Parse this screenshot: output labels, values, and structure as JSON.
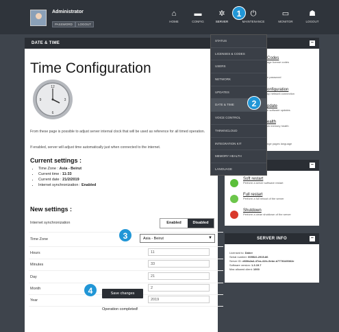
{
  "header": {
    "user_name": "Administrator",
    "password_btn": "PASSWORD",
    "logout_small_btn": "LOGOUT",
    "nav": [
      {
        "label": "HOME",
        "icon": "home-icon"
      },
      {
        "label": "CONFIG",
        "icon": "folder-icon"
      },
      {
        "label": "SERVER",
        "icon": "gear-icon"
      },
      {
        "label": "MAINTENANCE",
        "icon": "power-icon"
      },
      {
        "label": "MONITOR",
        "icon": "monitor-icon"
      },
      {
        "label": "LOGOUT",
        "icon": "user-logout-icon"
      }
    ]
  },
  "main": {
    "panel_title": "DATE & TIME",
    "heading": "Time Configuration",
    "desc1": "From these page is possible to adjust server internal clock that will be used as reference for all timed operation.",
    "desc2": "If enabled, server will adjust time automatically just when connected to the internet.",
    "current_title": "Current settings :",
    "current": [
      {
        "label": "Time Zone : ",
        "value": "Asia - Beirut"
      },
      {
        "label": "Current time : ",
        "value": "11:33"
      },
      {
        "label": "Current date : ",
        "value": "21/2/2019"
      },
      {
        "label": "Internet synchronization : ",
        "value": "Enabled"
      }
    ],
    "new_title": "New settings :",
    "sync_label": "Internet synchronization",
    "enabled_btn": "Enabled",
    "disabled_btn": "Disabled",
    "timezone_label": "Time Zone",
    "timezone_value": "Asia - Beirut",
    "hours_label": "Hours",
    "hours_value": "11",
    "minutes_label": "Minutes",
    "minutes_value": "33",
    "day_label": "Day",
    "day_value": "21",
    "month_label": "Month",
    "month_value": "2",
    "year_label": "Year",
    "year_value": "2019",
    "save_btn": "Save changes",
    "status_msg": "Operation completed!"
  },
  "dropdown": {
    "items": [
      "STATUS",
      "LICENSES & CODES",
      "USERS",
      "NETWORK",
      "UPDATES",
      "DATE & TIME",
      "VOICE CONTROL",
      "THINKNCLOUD",
      "INTEGRATION KIT",
      "MEMORY HEALTH",
      "LANGUAGE"
    ]
  },
  "right": {
    "top_items": [
      {
        "title": "Codes",
        "desc": "age license codes"
      },
      {
        "title": "",
        "desc": "e password"
      },
      {
        "title": "onfiguration",
        "desc": "up network connection"
      },
      {
        "title": "pdate",
        "desc": "e software updates"
      },
      {
        "title": "ealth",
        "desc": "ck memory health"
      },
      {
        "title": "",
        "desc": "nge pages language"
      }
    ],
    "actions": [
      {
        "title": "Soft restart",
        "desc": "Perform a server software restart"
      },
      {
        "title": "Full restart",
        "desc": "Perform a full reboot of the server"
      },
      {
        "title": "Shutdown",
        "desc": "Perform a clean shutdown of the server"
      }
    ],
    "server_info_title": "SERVER INFO",
    "server_info": [
      {
        "label": "Licensed to: ",
        "value": "Daher"
      },
      {
        "label": "Serial number: ",
        "value": "005522-2915-86"
      },
      {
        "label": "Server ID: ",
        "value": "d60fa2a4-47ea-41fc-9ebe-b7778145362e"
      },
      {
        "label": "Software version: ",
        "value": "1.3.19.7"
      },
      {
        "label": "Max allowed client: ",
        "value": "1000"
      }
    ]
  },
  "callouts": [
    "1",
    "2",
    "3",
    "4"
  ]
}
